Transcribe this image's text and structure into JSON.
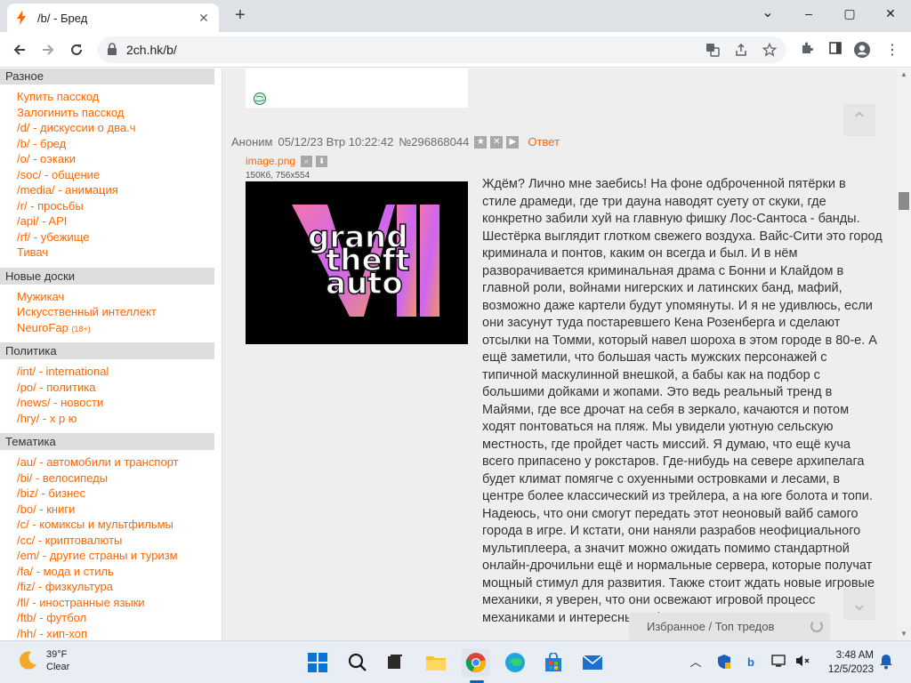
{
  "browser": {
    "tab_title": "/b/ - Бред",
    "url": "2ch.hk/b/",
    "new_tab_label": "+",
    "window": {
      "minimize": "–",
      "maximize": "▢",
      "close": "✕",
      "dropdown": "⌄"
    }
  },
  "sidebar": {
    "sections": [
      {
        "title": "Разное",
        "items": [
          {
            "label": "Купить пасскод"
          },
          {
            "label": "Залогинить пасскод"
          },
          {
            "label": "/d/ - дискуссии о два.ч"
          },
          {
            "label": "/b/ - бред"
          },
          {
            "label": "/o/ - оэкаки"
          },
          {
            "label": "/soc/ - общение"
          },
          {
            "label": "/media/ - анимация"
          },
          {
            "label": "/r/ - просьбы"
          },
          {
            "label": "/api/ - API"
          },
          {
            "label": "/rf/ - убежище"
          },
          {
            "label": "Тивач"
          }
        ]
      },
      {
        "title": "Новые доски",
        "items": [
          {
            "label": "Мужикач"
          },
          {
            "label": "Искусственный интеллект"
          },
          {
            "label": "NeuroFap",
            "tag": "(18+)"
          }
        ]
      },
      {
        "title": "Политика",
        "items": [
          {
            "label": "/int/ - international"
          },
          {
            "label": "/po/ - политика"
          },
          {
            "label": "/news/ - новости"
          },
          {
            "label": "/hry/ - х р ю"
          }
        ]
      },
      {
        "title": "Тематика",
        "items": [
          {
            "label": "/au/ - автомобили и транспорт"
          },
          {
            "label": "/bi/ - велосипеды"
          },
          {
            "label": "/biz/ - бизнес"
          },
          {
            "label": "/bo/ - книги"
          },
          {
            "label": "/c/ - комиксы и мультфильмы"
          },
          {
            "label": "/cc/ - криптовалюты"
          },
          {
            "label": "/em/ - другие страны и туризм"
          },
          {
            "label": "/fa/ - мода и стиль"
          },
          {
            "label": "/fiz/ - физкультура"
          },
          {
            "label": "/fl/ - иностранные языки"
          },
          {
            "label": "/ftb/ - футбол"
          },
          {
            "label": "/hh/ - хип-хоп"
          }
        ]
      }
    ]
  },
  "post": {
    "author": "Аноним",
    "datetime": "05/12/23 Втр 10:22:42",
    "number": "№296868044",
    "reply_label": "Ответ",
    "file_name": "image.png",
    "file_meta": "150Кб, 756x554",
    "image_text": {
      "line1": "grand",
      "line2": "theft",
      "line3": "auto",
      "numeral": "VI"
    },
    "text": "Ждём? Лично мне заебись! На фоне одброченной пятёрки в стиле драмеди, где три дауна наводят суету от скуки, где конкретно забили хуй на главную фишку Лос-Сантоса - банды. Шестёрка выглядит глотком свежего воздуха. Вайс-Сити это город криминала и понтов, каким он всегда и был. И в нём разворачивается криминальная драма с Бонни и Клайдом в главной роли, войнами нигерских и латинских банд, мафий, возможно даже картели будут упомянуты. И я не удивлюсь, если они засунут туда постаревшего Кена Розенберга и сделают отсылки на Томми, который навел шороха в этом городе в 80-е. А ещё заметили, что большая часть мужских персонажей с типичной маскулинной внешкой, а бабы как на подбор с большими дойками и жопами. Это ведь реальный тренд в Майями, где все дрочат на себя в зеркало, качаются и потом ходят понтоваться на пляж. Мы увидели уютную сельскую местность, где пройдет часть миссий. Я думаю, что ещё куча всего припасено у рокстаров. Где-нибудь на севере архипелага будет климат помягче с охуенными островками и лесами, в центре более классический из трейлера, а на юге болота и топи. Надеюсь, что они смогут передать этот неоновый вайб самого города в игре. И кстати, они наняли разрабов неофициального мультиплеера, а значит можно ожидать помимо стандартной онлайн-дрочильни ещё и нормальные сервера, которые получат мощный стимул для развития. Также стоит ждать новые игровые механики, я уверен, что они освежают игровой процесс механиками и интересными фишками..."
  },
  "floating": {
    "favorites_label": "Избранное / Топ тредов",
    "scroll_up": "⌃",
    "scroll_down": "⌄"
  },
  "taskbar": {
    "weather_temp": "39°F",
    "weather_desc": "Clear",
    "time": "3:48 AM",
    "date": "12/5/2023"
  },
  "colors": {
    "link": "#ff6600",
    "header_gray": "#dddddd",
    "page_bg": "#eeeeee"
  }
}
